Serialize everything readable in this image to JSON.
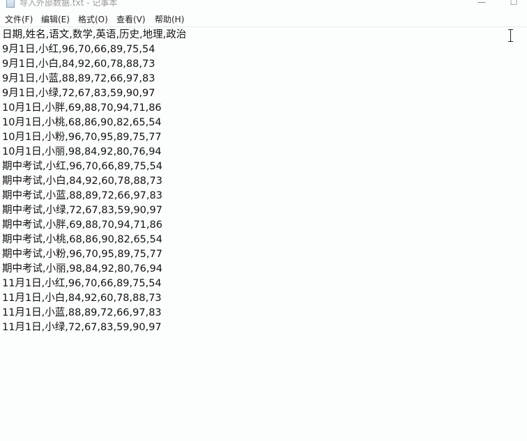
{
  "window": {
    "title": "导入外部数据.txt - 记事本",
    "minimize_glyph": "—",
    "maximize_glyph": "☐"
  },
  "menu": [
    "文件(F)",
    "编辑(E)",
    "格式(O)",
    "查看(V)",
    "帮助(H)"
  ],
  "icons": {
    "app": "notepad-icon",
    "cursor": "text-cursor-icon"
  },
  "document": {
    "lines": [
      "日期,姓名,语文,数学,英语,历史,地理,政治",
      "9月1日,小红,96,70,66,89,75,54",
      "9月1日,小白,84,92,60,78,88,73",
      "9月1日,小蓝,88,89,72,66,97,83",
      "9月1日,小绿,72,67,83,59,90,97",
      "10月1日,小胖,69,88,70,94,71,86",
      "10月1日,小桃,68,86,90,82,65,54",
      "10月1日,小粉,96,70,95,89,75,77",
      "10月1日,小丽,98,84,92,80,76,94",
      "期中考试,小红,96,70,66,89,75,54",
      "期中考试,小白,84,92,60,78,88,73",
      "期中考试,小蓝,88,89,72,66,97,83",
      "期中考试,小绿,72,67,83,59,90,97",
      "期中考试,小胖,69,88,70,94,71,86",
      "期中考试,小桃,68,86,90,82,65,54",
      "期中考试,小粉,96,70,95,89,75,77",
      "期中考试,小丽,98,84,92,80,76,94",
      "11月1日,小红,96,70,66,89,75,54",
      "11月1日,小白,84,92,60,78,88,73",
      "11月1日,小蓝,88,89,72,66,97,83",
      "11月1日,小绿,72,67,83,59,90,97"
    ]
  }
}
